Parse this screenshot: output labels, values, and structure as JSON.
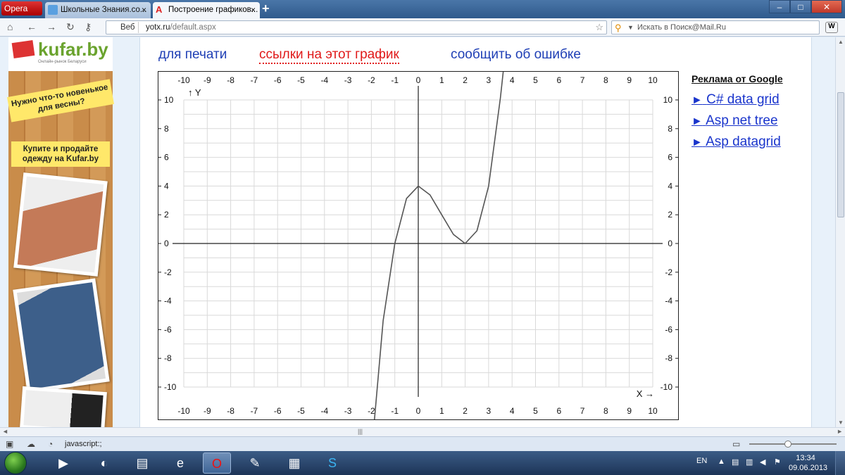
{
  "browser": {
    "menu_label": "Opera",
    "tabs": [
      {
        "title": "Школьные Знания.со...",
        "close": "×"
      },
      {
        "title": "Построение графиков...",
        "close": "×"
      }
    ],
    "newtab": "+",
    "window_buttons": {
      "minimize": "–",
      "maximize": "□",
      "close": "✕"
    },
    "address": {
      "mode_label": "Веб",
      "domain": "yotx.ru",
      "path": "/default.aspx"
    },
    "search_placeholder": "Искать в Поиск@Mail.Ru",
    "status_text": "javascript:;"
  },
  "banner": {
    "logo": "kufar.by",
    "tagline": "Онлайн-рынок Беларуси",
    "slogan1": "Нужно что-то новенькое для весны?",
    "slogan2": "Купите и продайте одежду на Kufar.by"
  },
  "links": {
    "print": "для печати",
    "refs": "ссылки на этот график",
    "error": "сообщить об ошибке"
  },
  "ads": {
    "title": "Реклама от Google",
    "items": [
      {
        "arrow": "►",
        "label": "C# data grid"
      },
      {
        "arrow": "►",
        "label": "Asp net tree"
      },
      {
        "arrow": "►",
        "label": "Asp datagrid"
      }
    ]
  },
  "chart_data": {
    "type": "line",
    "function_points_note": "",
    "x_ticks": [
      "-10",
      "-9",
      "-8",
      "-7",
      "-6",
      "-5",
      "-4",
      "-3",
      "-2",
      "-1",
      "0",
      "1",
      "2",
      "3",
      "4",
      "5",
      "6",
      "7",
      "8",
      "9",
      "10"
    ],
    "y_ticks": [
      "10",
      "8",
      "6",
      "4",
      "2",
      "0",
      "-2",
      "-4",
      "-6",
      "-8",
      "-10"
    ],
    "xlabel": "X",
    "ylabel": "Y",
    "xlim": [
      -10,
      10
    ],
    "ylim": [
      -10,
      10
    ],
    "grid": true,
    "series": [
      {
        "x": [
          -1.9,
          -1.5,
          -1,
          -0.5,
          0,
          0.5,
          1,
          1.5,
          2,
          2.5,
          3,
          3.5,
          3.75
        ],
        "y": [
          -12.87,
          -5.38,
          0,
          3.13,
          4,
          3.38,
          2,
          0.63,
          0,
          0.88,
          4,
          10.13,
          13.89
        ]
      }
    ],
    "color": "#555555"
  },
  "taskbar": {
    "lang": "EN",
    "time": "13:34",
    "date": "09.06.2013"
  }
}
